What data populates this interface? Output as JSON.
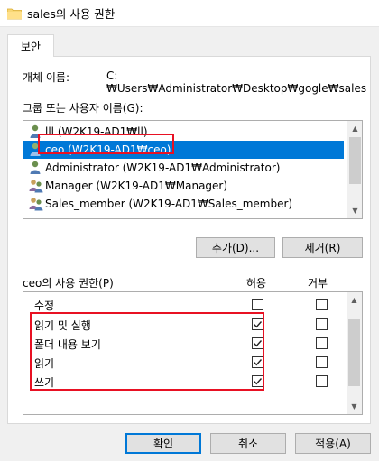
{
  "window": {
    "title": "sales의 사용 권한"
  },
  "tabs": [
    {
      "label": "보안"
    }
  ],
  "object": {
    "label": "개체 이름:",
    "value": "C:₩Users₩Administrator₩Desktop₩gogle₩sales"
  },
  "groups": {
    "label": "그룹 또는 사용자 이름(G):",
    "items": [
      {
        "label": "lll (W2K19-AD1₩ll)",
        "icon": "user-icon",
        "selected": false
      },
      {
        "label": "ceo (W2K19-AD1₩ceo)",
        "icon": "user-icon",
        "selected": true
      },
      {
        "label": "Administrator (W2K19-AD1₩Administrator)",
        "icon": "user-icon",
        "selected": false
      },
      {
        "label": "Manager (W2K19-AD1₩Manager)",
        "icon": "group-icon",
        "selected": false
      },
      {
        "label": "Sales_member (W2K19-AD1₩Sales_member)",
        "icon": "group-icon",
        "selected": false
      }
    ]
  },
  "buttons": {
    "add": "추가(D)...",
    "remove": "제거(R)",
    "ok": "확인",
    "cancel": "취소",
    "apply": "적용(A)"
  },
  "permissions": {
    "title": "ceo의 사용 권한(P)",
    "allow_label": "허용",
    "deny_label": "거부",
    "rows": [
      {
        "name": "수정",
        "allow": false,
        "deny": false
      },
      {
        "name": "읽기 및 실행",
        "allow": true,
        "deny": false
      },
      {
        "name": "폴더 내용 보기",
        "allow": true,
        "deny": false
      },
      {
        "name": "읽기",
        "allow": true,
        "deny": false
      },
      {
        "name": "쓰기",
        "allow": true,
        "deny": false
      }
    ]
  },
  "colors": {
    "selection": "#0078d7",
    "highlight": "#e81123"
  }
}
